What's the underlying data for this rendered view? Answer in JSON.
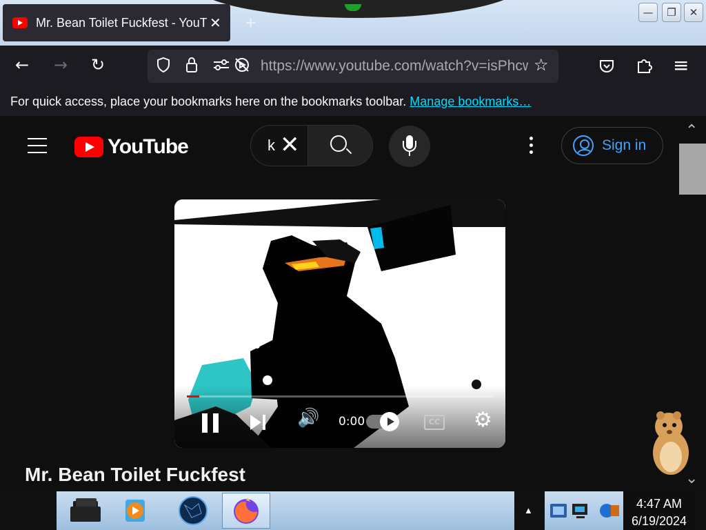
{
  "browser": {
    "tab_title": "Mr. Bean Toilet Fuckfest - YouTube",
    "tab_close": "✕",
    "new_tab": "+",
    "url": "https://www.youtube.com/watch?v=isPhcw",
    "window_buttons": {
      "minimize": "—",
      "restore": "❐",
      "close": "✕"
    },
    "nav": {
      "back": "←",
      "forward": "→",
      "reload": "↻",
      "bookmark_star": "☆",
      "menu": "≡"
    }
  },
  "bookmarks_bar": {
    "message": "For quick access, place your bookmarks here on the bookmarks toolbar.",
    "link": "Manage bookmarks…"
  },
  "youtube": {
    "logo_text": "YouTube",
    "search_query": "k",
    "clear": "✕",
    "sign_in": "Sign in",
    "scroll_up": "⌃",
    "scroll_down": "⌄"
  },
  "player": {
    "time": "0:00",
    "cc": "CC",
    "progress_fraction": 0.04,
    "volume_icon": "🔊",
    "settings_icon": "⚙"
  },
  "video": {
    "title": "Mr. Bean Toilet Fuckfest"
  },
  "taskbar": {
    "tray_arrow": "▲",
    "time": "4:47 AM",
    "date": "6/19/2024"
  },
  "colors": {
    "youtube_red": "#ff0000",
    "link_cyan": "#00ddff",
    "signin_blue": "#3ea6ff",
    "page_bg": "#0f0f0f"
  }
}
